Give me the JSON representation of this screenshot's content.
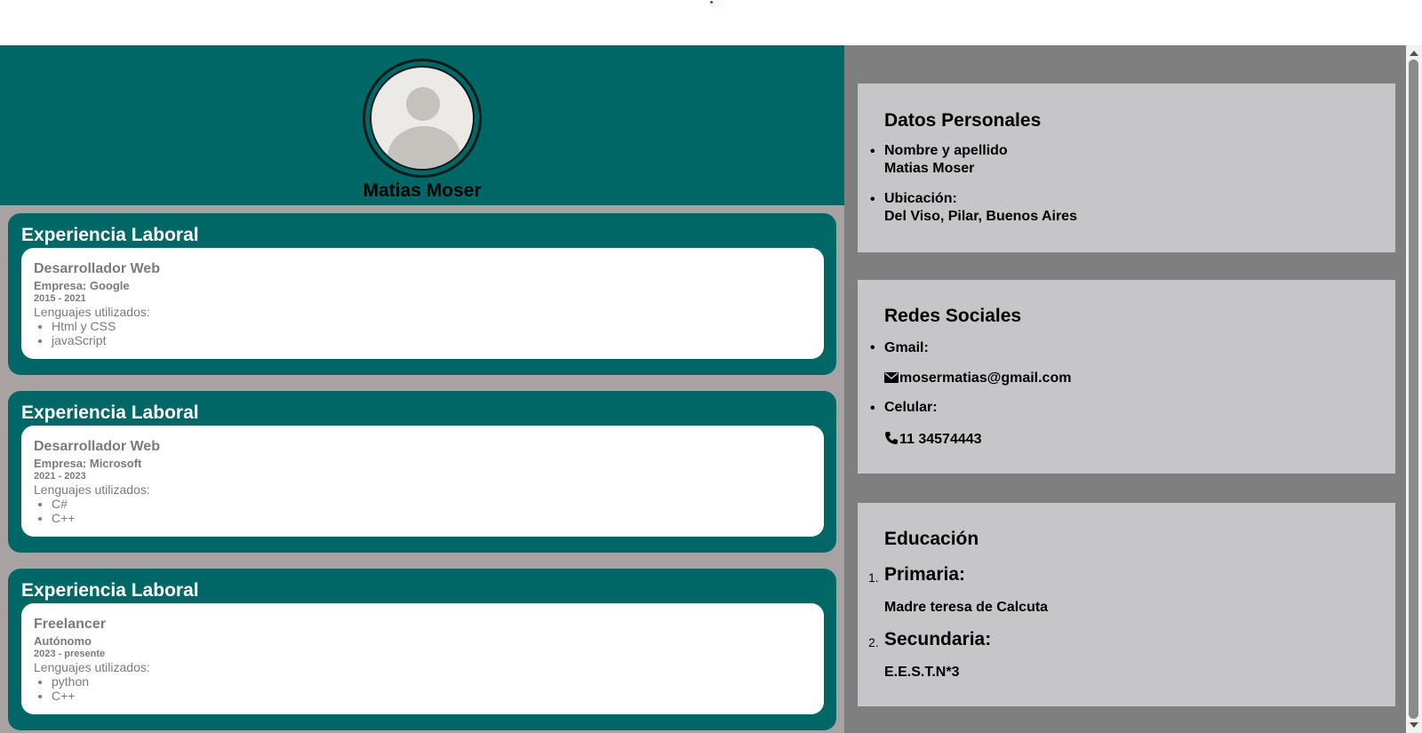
{
  "profile": {
    "name": "Matias Moser"
  },
  "experience": [
    {
      "section_title": "Experiencia Laboral",
      "job_title": "Desarrollador Web",
      "company": "Empresa: Google",
      "years": "2015 - 2021",
      "languages_label": "Lenguajes utilizados:",
      "languages": [
        "Html y CSS",
        "javaScript"
      ]
    },
    {
      "section_title": "Experiencia Laboral",
      "job_title": "Desarrollador Web",
      "company": "Empresa: Microsoft",
      "years": "2021 - 2023",
      "languages_label": "Lenguajes utilizados:",
      "languages": [
        "C#",
        "C++"
      ]
    },
    {
      "section_title": "Experiencia Laboral",
      "job_title": "Freelancer",
      "company": "Autónomo",
      "years": "2023 - presente",
      "languages_label": "Lenguajes utilizados:",
      "languages": [
        "python",
        "C++"
      ]
    }
  ],
  "personal": {
    "title": "Datos Personales",
    "name_label": "Nombre y apellido",
    "name_value": "Matias Moser",
    "location_label": "Ubicación:",
    "location_value": "Del Viso, Pilar, Buenos Aires"
  },
  "social": {
    "title": "Redes Sociales",
    "gmail_label": "Gmail:",
    "gmail_value": "mosermatias@gmail.com",
    "phone_label": "Celular:",
    "phone_value": "11 34574443"
  },
  "education": {
    "title": "Educación",
    "items": [
      {
        "number": "1.",
        "level": "Primaria:",
        "school": "Madre teresa de Calcuta"
      },
      {
        "number": "2.",
        "level": "Secundaria:",
        "school": "E.E.S.T.N*3"
      }
    ]
  },
  "colors": {
    "teal": "#006767",
    "left_bg": "#a8a2a3",
    "right_bg": "#7f7f7f",
    "box_bg": "#c6c6c8"
  },
  "icons": [
    "envelope-icon",
    "phone-icon",
    "avatar-placeholder"
  ]
}
